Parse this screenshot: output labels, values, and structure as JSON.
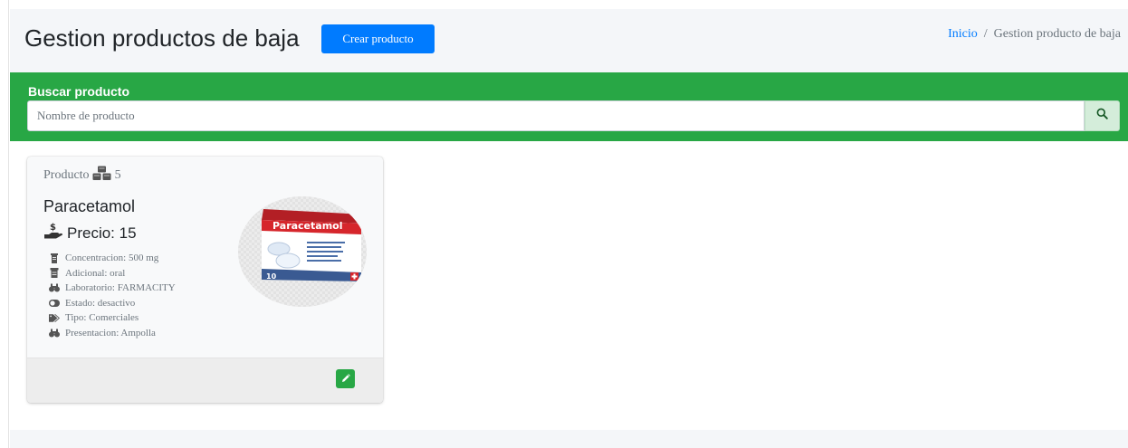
{
  "header": {
    "title": "Gestion productos de baja",
    "create_button_label": "Crear producto",
    "breadcrumb": {
      "home": "Inicio",
      "separator": "/",
      "current": "Gestion producto de baja"
    }
  },
  "search": {
    "label": "Buscar producto",
    "placeholder": "Nombre de producto",
    "value": "",
    "button_icon": "search-icon"
  },
  "product_card": {
    "header_label": "Producto",
    "header_icon": "cubes-icon",
    "stock": "5",
    "name": "Paracetamol",
    "price_icon": "hand-holding-dollar-icon",
    "price_text": "Precio: 15",
    "attributes": [
      {
        "icon": "mortar-pestle-icon",
        "text": "Concentracion: 500 mg"
      },
      {
        "icon": "prescription-bottle-icon",
        "text": "Adicional: oral"
      },
      {
        "icon": "flask-icon",
        "text": "Laboratorio: FARMACITY"
      },
      {
        "icon": "toggle-icon",
        "text": "Estado: desactivo"
      },
      {
        "icon": "tags-icon",
        "text": "Tipo: Comerciales"
      },
      {
        "icon": "pills-icon",
        "text": "Presentacion: Ampolla"
      }
    ],
    "image_text": "Paracetamol",
    "image_count": "10",
    "edit_icon": "pencil-icon"
  },
  "colors": {
    "primary": "#007bff",
    "success": "#28a745",
    "muted": "#6c757d",
    "page_header_bg": "#f4f6f9",
    "box_red": "#d6262c"
  }
}
